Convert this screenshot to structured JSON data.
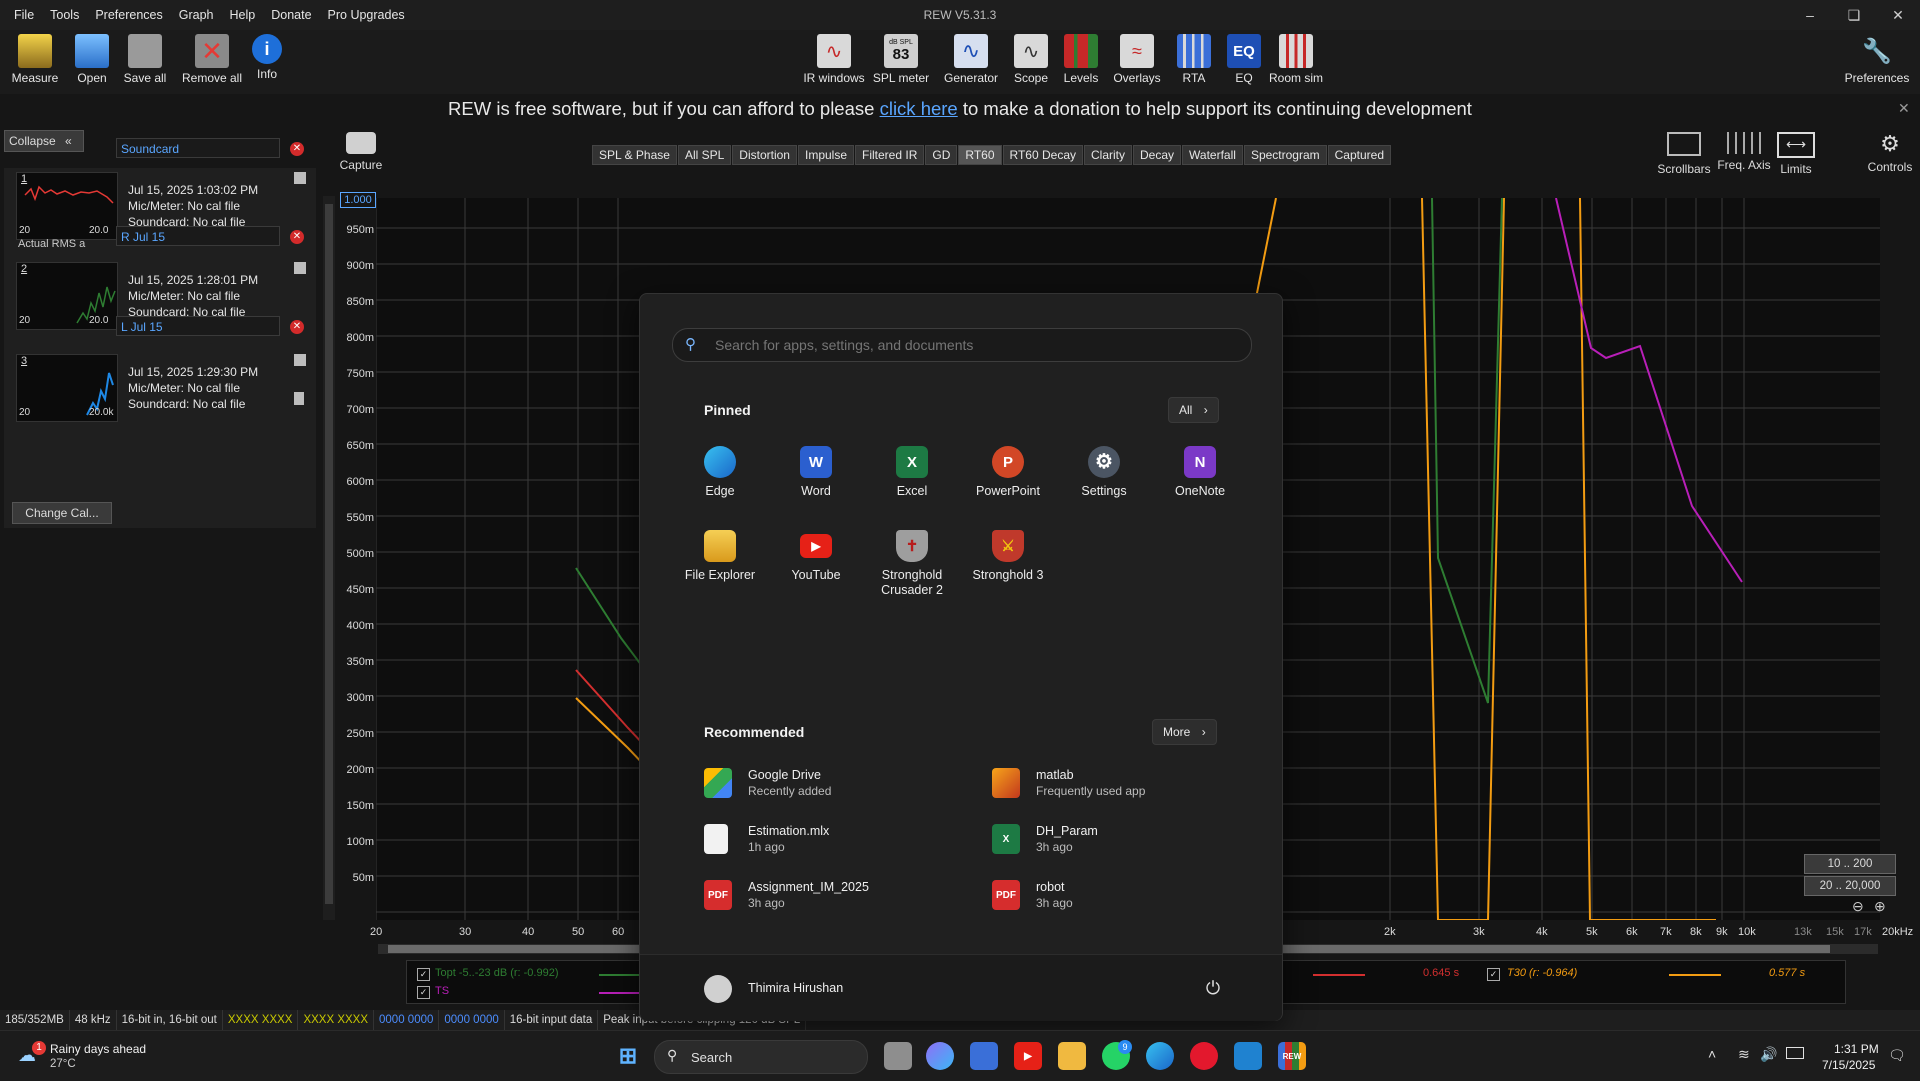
{
  "menu": [
    "File",
    "Tools",
    "Preferences",
    "Graph",
    "Help",
    "Donate",
    "Pro Upgrades"
  ],
  "app_title": "REW V5.31.3",
  "window_controls": [
    "minimize-icon",
    "restore-icon",
    "close-icon"
  ],
  "toolbar_left": [
    {
      "label": "Measure",
      "icon": "measure-icon"
    },
    {
      "label": "Open",
      "icon": "folder-icon"
    },
    {
      "label": "Save all",
      "icon": "save-icon"
    },
    {
      "label": "Remove all",
      "icon": "remove-icon"
    },
    {
      "label": "Info",
      "icon": "info-icon"
    }
  ],
  "toolbar_center": [
    {
      "label": "IR windows"
    },
    {
      "label": "SPL meter",
      "badge_top": "dB SPL",
      "badge_value": "83"
    },
    {
      "label": "Generator"
    },
    {
      "label": "Scope"
    },
    {
      "label": "Levels"
    },
    {
      "label": "Overlays"
    },
    {
      "label": "RTA"
    },
    {
      "label": "EQ",
      "badge_value": "EQ"
    },
    {
      "label": "Room sim"
    }
  ],
  "toolbar_right": {
    "label": "Preferences"
  },
  "banner": {
    "before": "REW is free software, but if you can afford to please ",
    "link": "click here",
    "after": " to make a donation to help support its continuing development"
  },
  "panel": {
    "collapse_label": "Collapse",
    "soundcard_label": "Soundcard",
    "measurements": [
      {
        "num": "1",
        "name": "R Jul 15",
        "date": "Jul 15, 2025 1:03:02 PM",
        "mic": "Mic/Meter: No cal file",
        "sc": "Soundcard: No cal file",
        "thumb_left": "20",
        "thumb_right": "20.0",
        "extra": "Actual RMS a"
      },
      {
        "num": "2",
        "name": "L Jul 15",
        "date": "Jul 15, 2025 1:28:01 PM",
        "mic": "Mic/Meter: No cal file",
        "sc": "Soundcard: No cal file",
        "thumb_left": "20",
        "thumb_right": "20.0"
      },
      {
        "num": "3",
        "name": "",
        "date": "Jul 15, 2025 1:29:30 PM",
        "mic": "Mic/Meter: No cal file",
        "sc": "Soundcard: No cal file",
        "thumb_left": "20",
        "thumb_right": "20.0k"
      }
    ],
    "change_cal_label": "Change Cal..."
  },
  "capture_label": "Capture",
  "tabs": [
    "SPL & Phase",
    "All SPL",
    "Distortion",
    "Impulse",
    "Filtered IR",
    "GD",
    "RT60",
    "RT60 Decay",
    "Clarity",
    "Decay",
    "Waterfall",
    "Spectrogram",
    "Captured"
  ],
  "active_tab": "RT60",
  "right_tools": [
    {
      "label": "Scrollbars"
    },
    {
      "label": "Freq. Axis"
    },
    {
      "label": "Limits"
    },
    {
      "label": "Controls"
    }
  ],
  "graph": {
    "y_top_box": "1.000",
    "y_labels": [
      "950m",
      "900m",
      "850m",
      "800m",
      "750m",
      "700m",
      "650m",
      "600m",
      "550m",
      "500m",
      "450m",
      "400m",
      "350m",
      "300m",
      "250m",
      "200m",
      "150m",
      "100m",
      "50m"
    ],
    "x_labels": [
      "20",
      "30",
      "40",
      "50",
      "60",
      "2k",
      "3k",
      "4k",
      "5k",
      "6k",
      "7k",
      "8k",
      "9k",
      "10k",
      "13k",
      "15k",
      "17k",
      "20kHz"
    ],
    "range_buttons": [
      "10 .. 200",
      "20 .. 20,000"
    ]
  },
  "legend": {
    "topt": "Topt -5..-23 dB (r: -0.992)",
    "ts": "TS",
    "val_red": "0.645 s",
    "t30": "T30 (r: -0.964)",
    "val_orange": "0.577 s"
  },
  "status": [
    "185/352MB",
    "48 kHz",
    "16-bit in, 16-bit out",
    "XXXX XXXX",
    "XXXX XXXX",
    "0000 0000",
    "0000 0000",
    "16-bit input data",
    "Peak input before clipping 120 dB SPL"
  ],
  "start_menu": {
    "search_placeholder": "Search for apps, settings, and documents",
    "pinned_title": "Pinned",
    "all_label": "All",
    "pinned": [
      {
        "label": "Edge",
        "color": "#1f8fd8"
      },
      {
        "label": "Word",
        "color": "#2b5fcf"
      },
      {
        "label": "Excel",
        "color": "#1d7a44"
      },
      {
        "label": "PowerPoint",
        "color": "#d24726"
      },
      {
        "label": "Settings",
        "color": "#6d7b8c"
      },
      {
        "label": "OneNote",
        "color": "#7b39c7"
      },
      {
        "label": "File Explorer",
        "color": "#e2b13c"
      },
      {
        "label": "YouTube",
        "color": "#e62117"
      },
      {
        "label": "Stronghold Crusader 2",
        "color": "#8d8d8d"
      },
      {
        "label": "Stronghold 3",
        "color": "#c0392b"
      }
    ],
    "recommended_title": "Recommended",
    "more_label": "More",
    "recommended": [
      {
        "title": "Google Drive",
        "sub": "Recently added",
        "color": "#1e8e3e"
      },
      {
        "title": "matlab",
        "sub": "Frequently used app",
        "color": "#e16a25"
      },
      {
        "title": "Estimation.mlx",
        "sub": "1h ago",
        "color": "#f2f2f2"
      },
      {
        "title": "DH_Param",
        "sub": "3h ago",
        "color": "#1d7a44"
      },
      {
        "title": "Assignment_IM_2025",
        "sub": "3h ago",
        "color": "#d62d2d"
      },
      {
        "title": "robot",
        "sub": "3h ago",
        "color": "#d62d2d"
      }
    ],
    "user_name": "Thimira Hirushan"
  },
  "taskbar": {
    "weather_title": "Rainy days ahead",
    "weather_temp": "27°C",
    "weather_badge": "1",
    "search_label": "Search",
    "whatsapp_badge": "9",
    "time": "1:31 PM",
    "date": "7/15/2025"
  }
}
